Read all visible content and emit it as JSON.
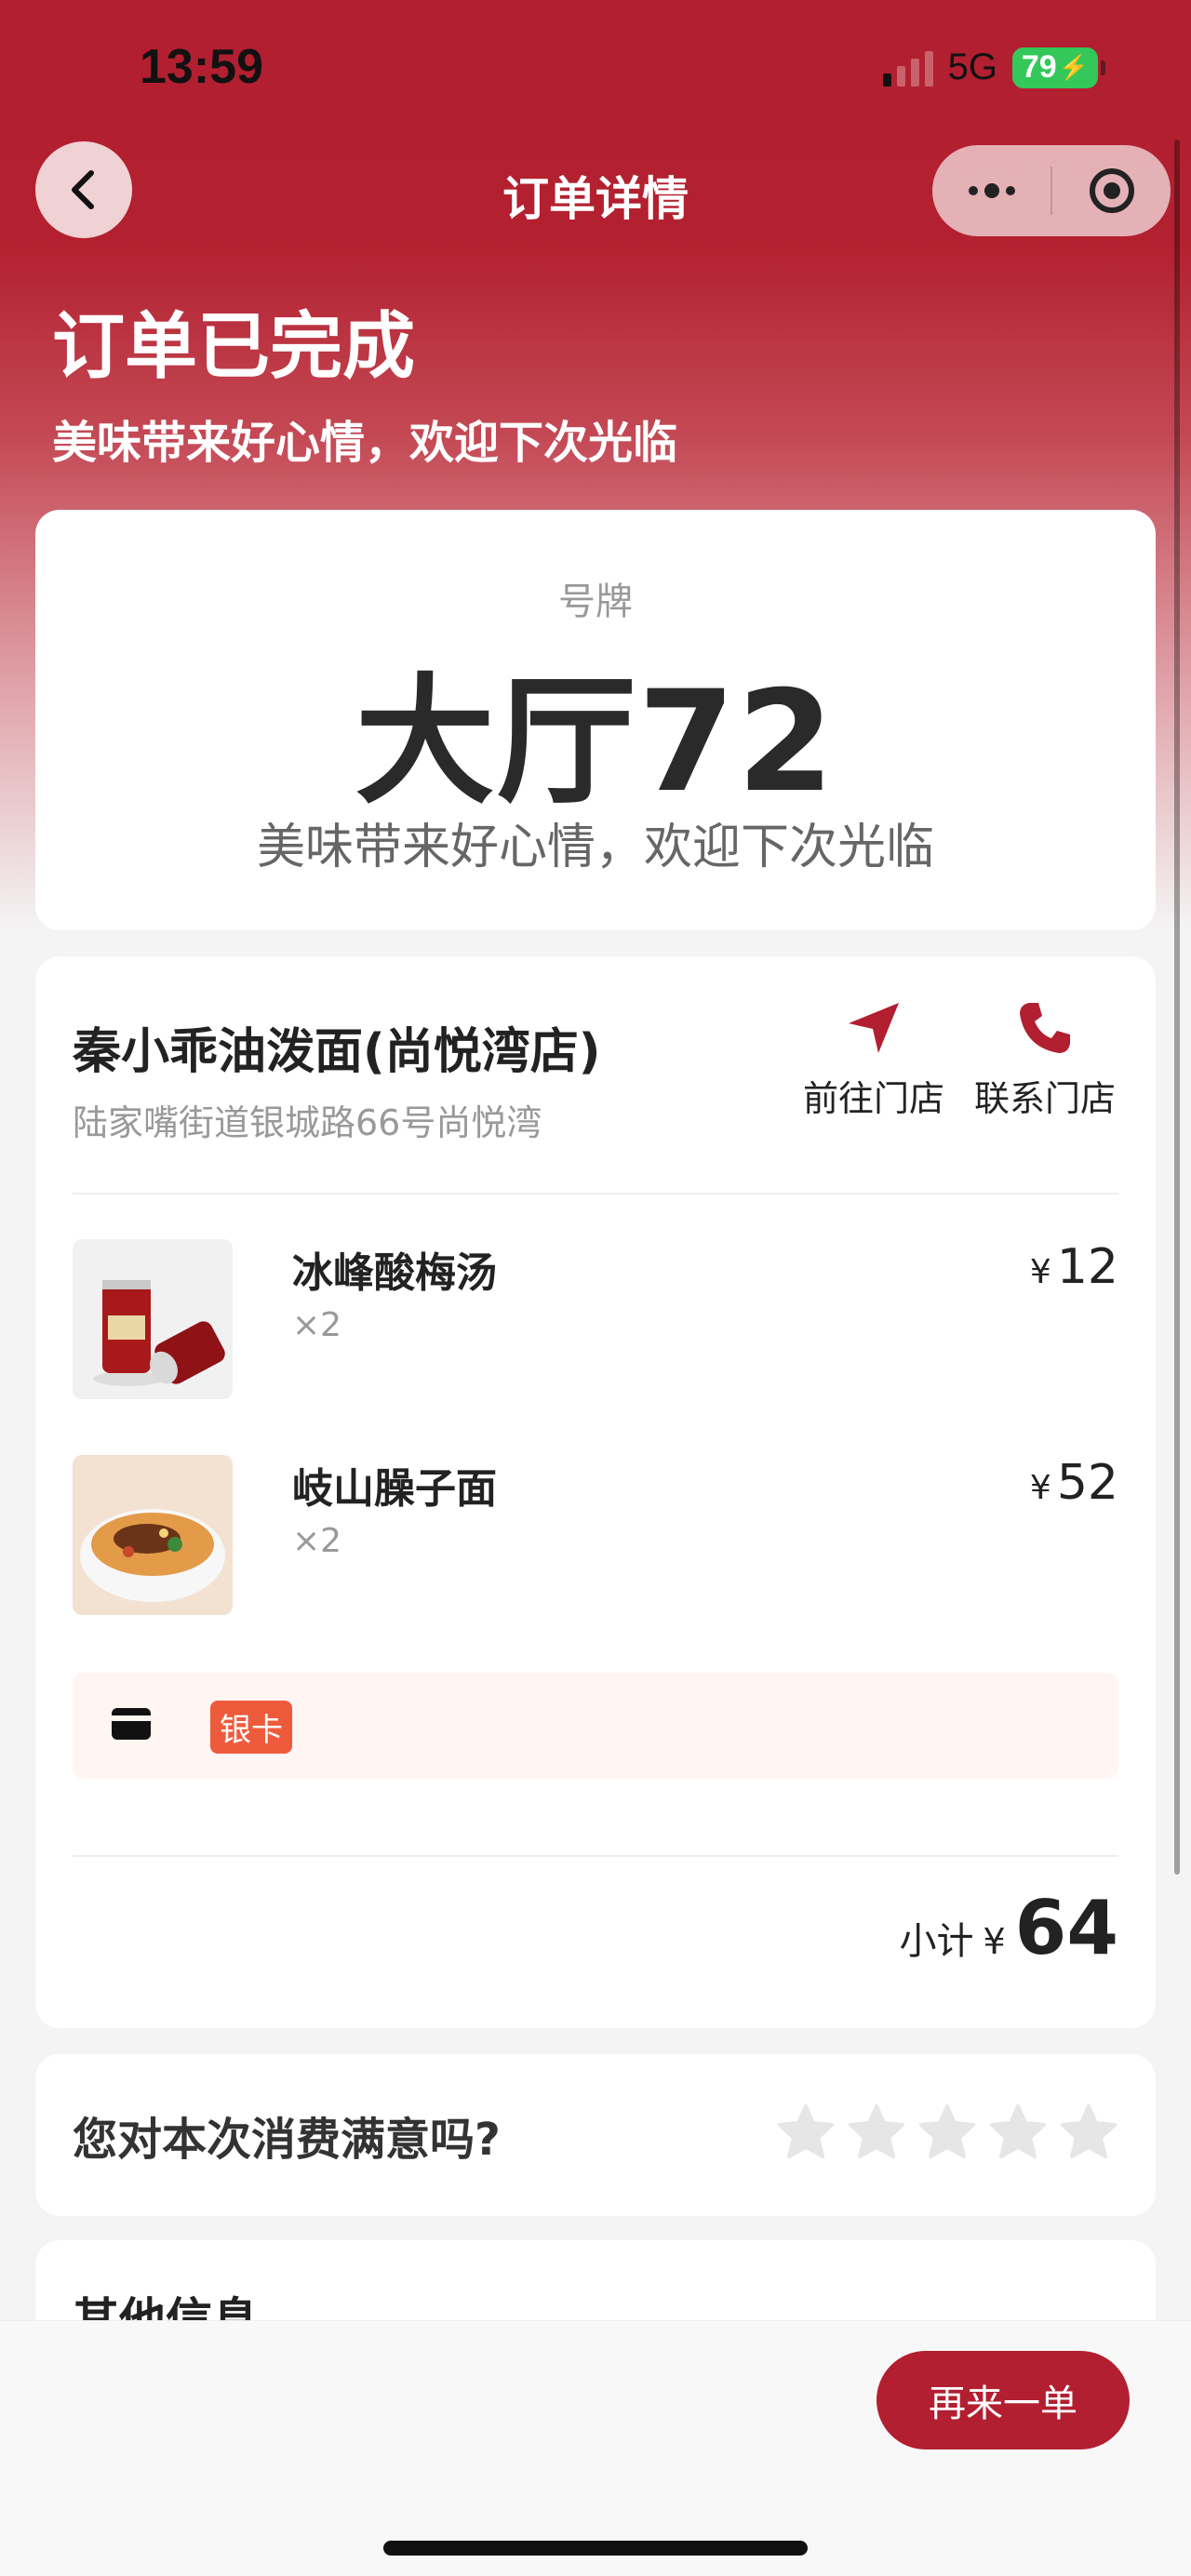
{
  "status_bar": {
    "time": "13:59",
    "network": "5G",
    "battery": "79"
  },
  "nav": {
    "title": "订单详情"
  },
  "order_status": {
    "title": "订单已完成",
    "subtitle": "美味带来好心情，欢迎下次光临"
  },
  "ticket": {
    "label": "号牌",
    "number": "大厅72",
    "message": "美味带来好心情，欢迎下次光临"
  },
  "store": {
    "name": "秦小乖油泼面(尚悦湾店)",
    "address": "陆家嘴街道银城路66号尚悦湾",
    "navigate_label": "前往门店",
    "contact_label": "联系门店"
  },
  "items": [
    {
      "name": "冰峰酸梅汤",
      "qty": "×2",
      "currency": "¥",
      "price": "12"
    },
    {
      "name": "岐山臊子面",
      "qty": "×2",
      "currency": "¥",
      "price": "52"
    }
  ],
  "payment": {
    "method": "银卡"
  },
  "subtotal": {
    "label": "小计",
    "currency": "¥",
    "value": "64"
  },
  "rating": {
    "question": "您对本次消费满意吗?"
  },
  "other": {
    "title": "其他信息"
  },
  "actions": {
    "reorder_label": "再来一单"
  },
  "colors": {
    "brand": "#b21f30",
    "badge": "#ee5b3c",
    "battery": "#34c759"
  },
  "icons": {
    "back": "chevron-left-icon",
    "more": "more-dots-icon",
    "close": "target-circle-icon",
    "navigate": "navigation-arrow-icon",
    "phone": "phone-icon",
    "card": "card-icon",
    "star": "star-icon"
  }
}
